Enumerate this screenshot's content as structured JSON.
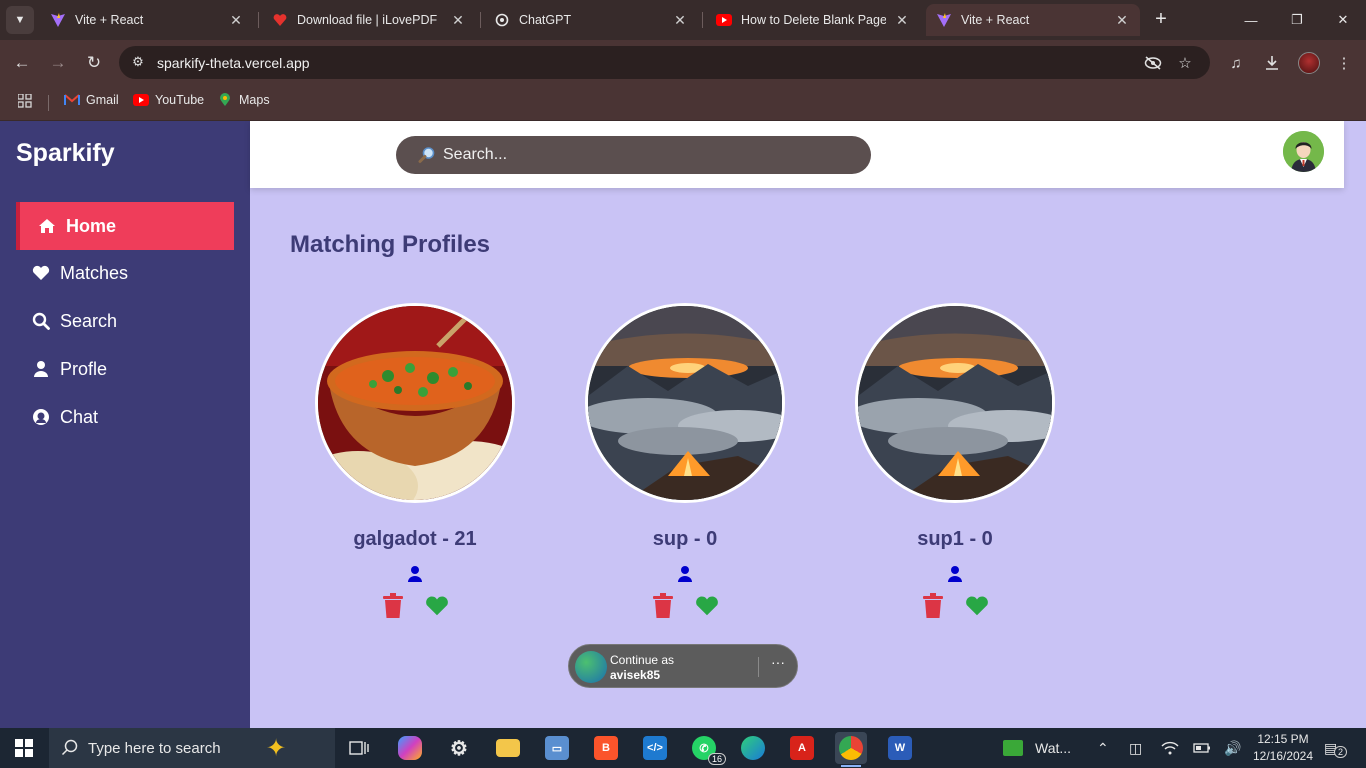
{
  "browser": {
    "tabs": [
      {
        "title": "Vite + React",
        "favicon": "vite-icon",
        "active": false
      },
      {
        "title": "Download file | iLovePDF",
        "favicon": "ilovepdf-heart-icon",
        "active": false
      },
      {
        "title": "ChatGPT",
        "favicon": "openai-icon",
        "active": false
      },
      {
        "title": "How to Delete Blank Page in",
        "favicon": "youtube-icon",
        "active": false
      },
      {
        "title": "Vite + React",
        "favicon": "vite-icon",
        "active": true
      }
    ],
    "address": "sparkify-theta.vercel.app",
    "bookmarks": [
      {
        "label": "Gmail",
        "icon": "gmail-icon"
      },
      {
        "label": "YouTube",
        "icon": "youtube-icon"
      },
      {
        "label": "Maps",
        "icon": "maps-icon"
      }
    ]
  },
  "app": {
    "brand": "Sparkify",
    "nav": [
      {
        "label": "Home",
        "icon": "home-icon",
        "active": true
      },
      {
        "label": "Matches",
        "icon": "heart-icon",
        "active": false
      },
      {
        "label": "Search",
        "icon": "search-icon",
        "active": false
      },
      {
        "label": "Profle",
        "icon": "user-icon",
        "active": false
      },
      {
        "label": "Chat",
        "icon": "chat-icon",
        "active": false
      }
    ],
    "search_placeholder": "Search...",
    "section_title": "Matching Profiles",
    "profiles": [
      {
        "name": "galgadot - 21",
        "photo": "food-curry-photo"
      },
      {
        "name": "sup - 0",
        "photo": "mountain-tent-photo"
      },
      {
        "name": "sup1 - 0",
        "photo": "mountain-tent-photo"
      }
    ],
    "google_signin": {
      "line1": "Continue as",
      "line2": "avisek85",
      "more": "···"
    },
    "colors": {
      "sidebar": "#3d3b76",
      "active_nav": "#ef3d5a",
      "page_bg": "#c9c3f5",
      "delete": "#dc3545",
      "like": "#28a745",
      "person": "#0000cc"
    }
  },
  "taskbar": {
    "search_placeholder": "Type here to search",
    "weather": "Wat...",
    "whatsapp_badge": "16",
    "time": "12:15 PM",
    "date": "12/16/2024",
    "notifications": "2"
  }
}
